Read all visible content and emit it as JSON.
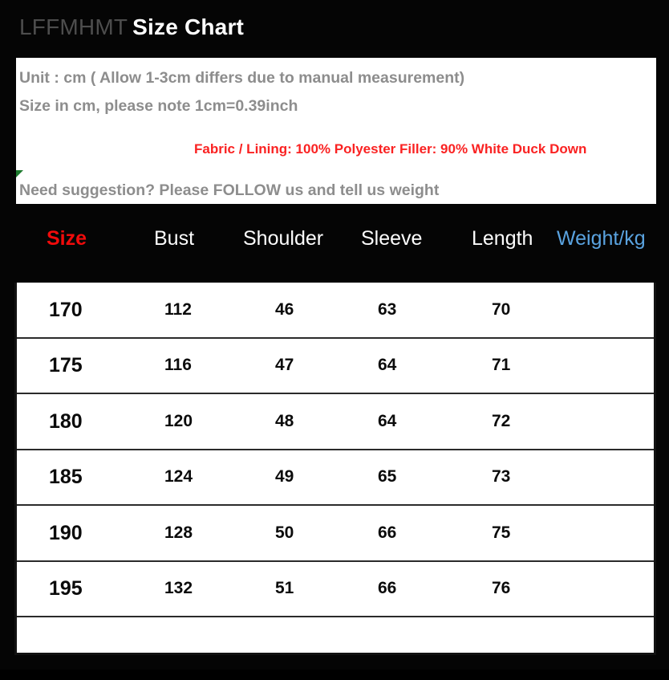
{
  "header": {
    "brand": "LFFMHMT",
    "title": "Size Chart"
  },
  "info": {
    "line1": "Unit : cm ( Allow 1-3cm differs due to manual measurement)",
    "line2": "Size in cm, please note 1cm=0.39inch",
    "line3_red": "Fabric / Lining: 100% Polyester    Filler: 90% White Duck Down",
    "line4": "Need suggestion? Please FOLLOW us and tell us weight",
    "colors": {
      "gray_text": "#8d8d8d",
      "red_text": "#fa2222",
      "panel_bg": "#ffffff"
    }
  },
  "colors": {
    "background": "#050505",
    "size_header": "#f10b0b",
    "weight_header": "#5aa3e0",
    "header_text": "#fdfdfd",
    "cell_text": "#0b0b0b",
    "row_divider": "#2b2b2b"
  },
  "chart_data": {
    "type": "table",
    "title": "LFFMHMT Size Chart",
    "columns": [
      "Size",
      "Bust",
      "Shoulder",
      "Sleeve",
      "Length",
      "Weight/kg"
    ],
    "rows": [
      {
        "size": "170",
        "bust": "112",
        "shoulder": "46",
        "sleeve": "63",
        "length": "70",
        "weight": ""
      },
      {
        "size": "175",
        "bust": "116",
        "shoulder": "47",
        "sleeve": "64",
        "length": "71",
        "weight": ""
      },
      {
        "size": "180",
        "bust": "120",
        "shoulder": "48",
        "sleeve": "64",
        "length": "72",
        "weight": ""
      },
      {
        "size": "185",
        "bust": "124",
        "shoulder": "49",
        "sleeve": "65",
        "length": "73",
        "weight": ""
      },
      {
        "size": "190",
        "bust": "128",
        "shoulder": "50",
        "sleeve": "66",
        "length": "75",
        "weight": ""
      },
      {
        "size": "195",
        "bust": "132",
        "shoulder": "51",
        "sleeve": "66",
        "length": "76",
        "weight": ""
      },
      {
        "size": "",
        "bust": "",
        "shoulder": "",
        "sleeve": "",
        "length": "",
        "weight": ""
      }
    ],
    "units": "cm",
    "notes": [
      "Unit : cm ( Allow 1-3cm differs due to manual measurement)",
      "Size in cm, please note 1cm=0.39inch",
      "Fabric / Lining: 100% Polyester    Filler: 90% White Duck Down",
      "Need suggestion? Please FOLLOW us and tell us weight"
    ]
  }
}
